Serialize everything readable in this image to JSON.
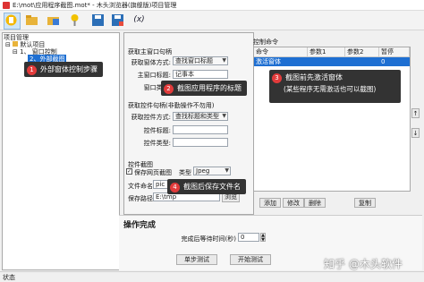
{
  "window": {
    "title": "E:\\mot\\应用程序截图.mot* - 木头浏览器(旗舰版)项目管理"
  },
  "toolbar": {
    "icons": [
      "new-file-icon",
      "open-folder-icon",
      "open-project-icon",
      "pin-icon",
      "save-icon",
      "save-as-icon",
      "variable-icon"
    ],
    "var_glyph": "(x)"
  },
  "tree": {
    "header": "项目管理",
    "items": [
      {
        "toggle": "⊟",
        "label": "默认项目"
      },
      {
        "toggle": "⊟",
        "label": "1、 窗口控制"
      },
      {
        "toggle": "",
        "label": "2、外部截图"
      }
    ]
  },
  "window_settings": {
    "section": "获取主窗口句柄",
    "method_label": "获取窗体方式:",
    "method_value": "查找窗口标题",
    "title_label": "主窗口标题:",
    "title_value": "记事本",
    "class_label": "窗口类名:"
  },
  "control_settings": {
    "section": "获取控件句柄(非勤操作不勿用)",
    "method_label": "获取控件方式:",
    "method_value": "查找标题和类型",
    "title_label": "控件标题:",
    "type_label": "控件类型:"
  },
  "screenshot": {
    "section": "控件截图",
    "checkbox_label": "保存网页截图",
    "type_label": "类型",
    "type_value": "Jpeg",
    "filename_label": "文件命名",
    "filename_value": "pic",
    "path_label": "保存路径",
    "path_value": "E:\\tmp",
    "browse_label": "浏览"
  },
  "commands": {
    "header": "控制命令",
    "columns": [
      "命令",
      "参数1",
      "参数2",
      "暂停"
    ],
    "rows": [
      {
        "cmd": "激活窗体",
        "p1": "",
        "p2": "",
        "pause": "0"
      }
    ],
    "buttons": [
      "添加",
      "修改",
      "删除",
      "复制"
    ],
    "up": "↑",
    "down": "↓"
  },
  "footer": {
    "section": "操作完成",
    "wait_label": "完成后等待时间(秒)",
    "wait_value": "0",
    "step_test": "单步测试",
    "start_test": "开始测试"
  },
  "callouts": [
    {
      "num": "1",
      "text": "外部窗体控制步骤"
    },
    {
      "num": "2",
      "text": "截图应用程序的标题"
    },
    {
      "num": "3",
      "text": "截图前先激活窗体",
      "sub": "(某些程序无需激活也可以截图)"
    },
    {
      "num": "4",
      "text": "截图后保存文件名"
    }
  ],
  "watermark": "知乎 @木头软件",
  "statusbar": {
    "text": "状态"
  }
}
